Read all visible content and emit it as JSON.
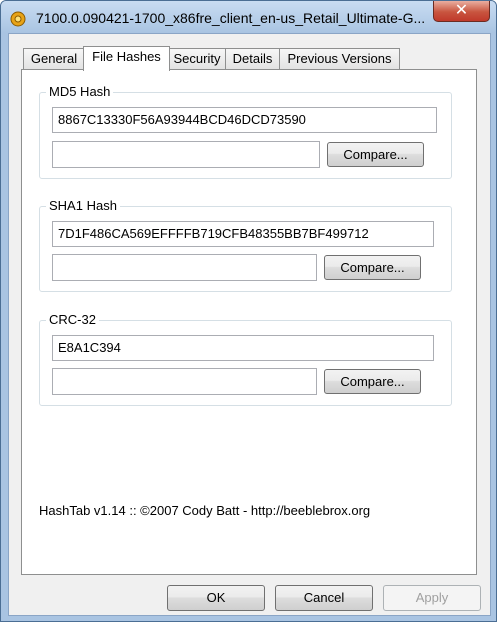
{
  "window": {
    "title": "7100.0.090421-1700_x86fre_client_en-us_Retail_Ultimate-G...",
    "close_glyph": "✕"
  },
  "tabs": [
    {
      "label": "General",
      "active": false
    },
    {
      "label": "File Hashes",
      "active": true
    },
    {
      "label": "Security",
      "active": false
    },
    {
      "label": "Details",
      "active": false
    },
    {
      "label": "Previous Versions",
      "active": false
    }
  ],
  "hashes": {
    "md5": {
      "label": "MD5 Hash",
      "value": "8867C13330F56A93944BCD46DCD73590",
      "compare_value": "",
      "compare_label": "Compare..."
    },
    "sha1": {
      "label": "SHA1 Hash",
      "value": "7D1F486CA569EFFFFB719CFB48355BB7BF499712",
      "compare_value": "",
      "compare_label": "Compare..."
    },
    "crc32": {
      "label": "CRC-32",
      "value": "E8A1C394",
      "compare_value": "",
      "compare_label": "Compare..."
    }
  },
  "footer": {
    "text": "HashTab v1.14 :: ©2007 Cody Batt  -  http://beeblebrox.org"
  },
  "buttons": {
    "ok": "OK",
    "cancel": "Cancel",
    "apply": "Apply"
  },
  "icons": {
    "app": "hashtab-app-icon",
    "close": "close-icon"
  }
}
